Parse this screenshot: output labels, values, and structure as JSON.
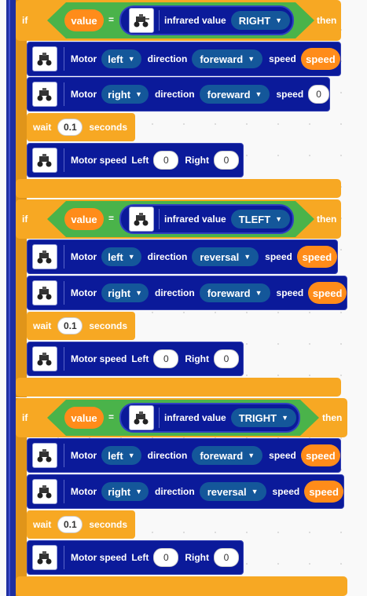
{
  "blocks": [
    {
      "if_label": "if",
      "then_label": "then",
      "variable": "value",
      "operator": "=",
      "sensor_label": "infrared value",
      "sensor_option": "RIGHT",
      "motor1": {
        "label": "Motor",
        "side": "left",
        "dir_label": "direction",
        "direction": "foreward",
        "speed_label": "speed",
        "speed": "speed"
      },
      "motor2": {
        "label": "Motor",
        "side": "right",
        "dir_label": "direction",
        "direction": "foreward",
        "speed_label": "speed",
        "speed": "0"
      },
      "wait": {
        "label": "wait",
        "value": "0.1",
        "unit": "seconds"
      },
      "motor_speed": {
        "label": "Motor speed",
        "left_label": "Left",
        "left": "0",
        "right_label": "Right",
        "right": "0"
      }
    },
    {
      "if_label": "if",
      "then_label": "then",
      "variable": "value",
      "operator": "=",
      "sensor_label": "infrared value",
      "sensor_option": "TLEFT",
      "motor1": {
        "label": "Motor",
        "side": "left",
        "dir_label": "direction",
        "direction": "reversal",
        "speed_label": "speed",
        "speed": "speed"
      },
      "motor2": {
        "label": "Motor",
        "side": "right",
        "dir_label": "direction",
        "direction": "foreward",
        "speed_label": "speed",
        "speed": "speed"
      },
      "wait": {
        "label": "wait",
        "value": "0.1",
        "unit": "seconds"
      },
      "motor_speed": {
        "label": "Motor speed",
        "left_label": "Left",
        "left": "0",
        "right_label": "Right",
        "right": "0"
      }
    },
    {
      "if_label": "if",
      "then_label": "then",
      "variable": "value",
      "operator": "=",
      "sensor_label": "infrared value",
      "sensor_option": "TRIGHT",
      "motor1": {
        "label": "Motor",
        "side": "left",
        "dir_label": "direction",
        "direction": "foreward",
        "speed_label": "speed",
        "speed": "speed"
      },
      "motor2": {
        "label": "Motor",
        "side": "right",
        "dir_label": "direction",
        "direction": "reversal",
        "speed_label": "speed",
        "speed": "speed"
      },
      "wait": {
        "label": "wait",
        "value": "0.1",
        "unit": "seconds"
      },
      "motor_speed": {
        "label": "Motor speed",
        "left_label": "Left",
        "left": "0",
        "right_label": "Right",
        "right": "0"
      }
    }
  ],
  "icons": {
    "robot": "robot-car-icon",
    "dropdown": "caret-down-icon"
  },
  "colors": {
    "control": "#f7a823",
    "motor_block": "#0b1a9a",
    "condition": "#4ab34a",
    "variable": "#ff8c1a",
    "dropdown": "#14579a"
  }
}
